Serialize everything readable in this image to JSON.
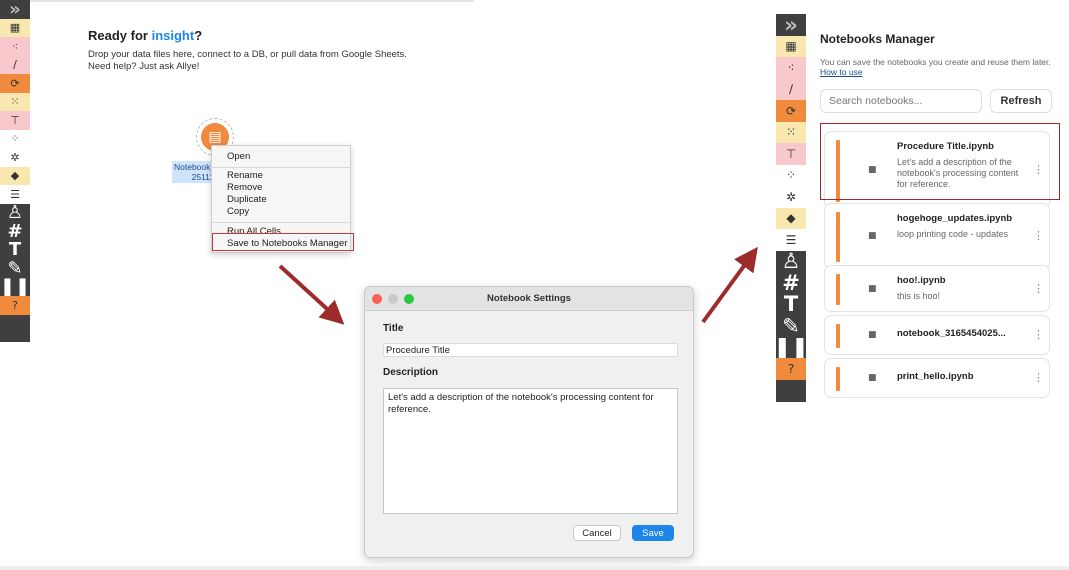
{
  "palette_tools": [
    {
      "name": "collapse-toggle",
      "glyph": "»",
      "bg": "#3f3f3f",
      "dark": true
    },
    {
      "name": "table-tool",
      "glyph": "▦",
      "bg": "#f8e8b0"
    },
    {
      "name": "network-tool",
      "glyph": "⁖",
      "bg": "#f8c8cc"
    },
    {
      "name": "line-tool",
      "glyph": "∕",
      "bg": "#f8c8cc"
    },
    {
      "name": "refresh-tool",
      "glyph": "⟳",
      "bg": "#f08a3c"
    },
    {
      "name": "scatter-tool",
      "glyph": "⁙",
      "bg": "#f8e8b0"
    },
    {
      "name": "hierarchy-tool",
      "glyph": "⊤",
      "bg": "#f8c8cc"
    },
    {
      "name": "matrix-tool",
      "glyph": "⁘",
      "bg": "#ffffff"
    },
    {
      "name": "cluster-tool",
      "glyph": "✲",
      "bg": "#ffffff"
    },
    {
      "name": "cube-tool",
      "glyph": "◆",
      "bg": "#f8e8b0"
    },
    {
      "name": "notebook-tool",
      "glyph": "☰",
      "bg": "#ffffff"
    },
    {
      "name": "person-tool",
      "glyph": "♙",
      "bg": "#3f3f3f",
      "dark": true
    },
    {
      "name": "hash-tool",
      "glyph": "#",
      "bg": "#3f3f3f",
      "dark": true
    },
    {
      "name": "text-tool",
      "glyph": "T",
      "bg": "#3f3f3f",
      "dark": true
    },
    {
      "name": "pencil-tool",
      "glyph": "✎",
      "bg": "#3f3f3f",
      "dark": true
    },
    {
      "name": "pause-tool",
      "glyph": "❚❚",
      "bg": "#3f3f3f",
      "dark": true
    },
    {
      "name": "help-tool",
      "glyph": "?",
      "bg": "#f08a3c"
    }
  ],
  "canvas": {
    "title_prefix": "Ready for ",
    "title_accent": "insight",
    "title_suffix": "?",
    "desc_line1": "Drop your data files here, connect to a DB, or pull data from Google Sheets.",
    "desc_line2": "Need help? Just ask Allye!",
    "node_label_line1": "Notebook_",
    "node_label_line2": "25111"
  },
  "context_menu": {
    "open": "Open",
    "rename": "Rename",
    "remove": "Remove",
    "duplicate": "Duplicate",
    "copy": "Copy",
    "run_all": "Run All Cells",
    "save_to_manager": "Save to Notebooks Manager"
  },
  "dialog": {
    "window_title": "Notebook Settings",
    "title_label": "Title",
    "title_value": "Procedure Title",
    "description_label": "Description",
    "description_value": "Let's add a description of the notebook's processing content for reference.",
    "cancel": "Cancel",
    "save": "Save"
  },
  "manager": {
    "title": "Notebooks Manager",
    "desc": "You can save the notebooks you create and reuse them later.",
    "how_to_use": "How to use",
    "search_placeholder": "Search notebooks...",
    "refresh": "Refresh",
    "notebooks": [
      {
        "name": "Procedure Title.ipynb",
        "desc": "Let's add a description of the notebook's processing content for reference."
      },
      {
        "name": "hogehoge_updates.ipynb",
        "desc": "loop printing code - updates"
      },
      {
        "name": "hoo!.ipynb",
        "desc": "this is hoo!"
      },
      {
        "name": "notebook_3165454025...",
        "desc": ""
      },
      {
        "name": "print_hello.ipynb",
        "desc": ""
      }
    ]
  },
  "colors": {
    "accent": "#1e86e8",
    "orange": "#f08a3c",
    "highlight_red": "#c23b3b",
    "arrow": "#9e2b2b"
  }
}
